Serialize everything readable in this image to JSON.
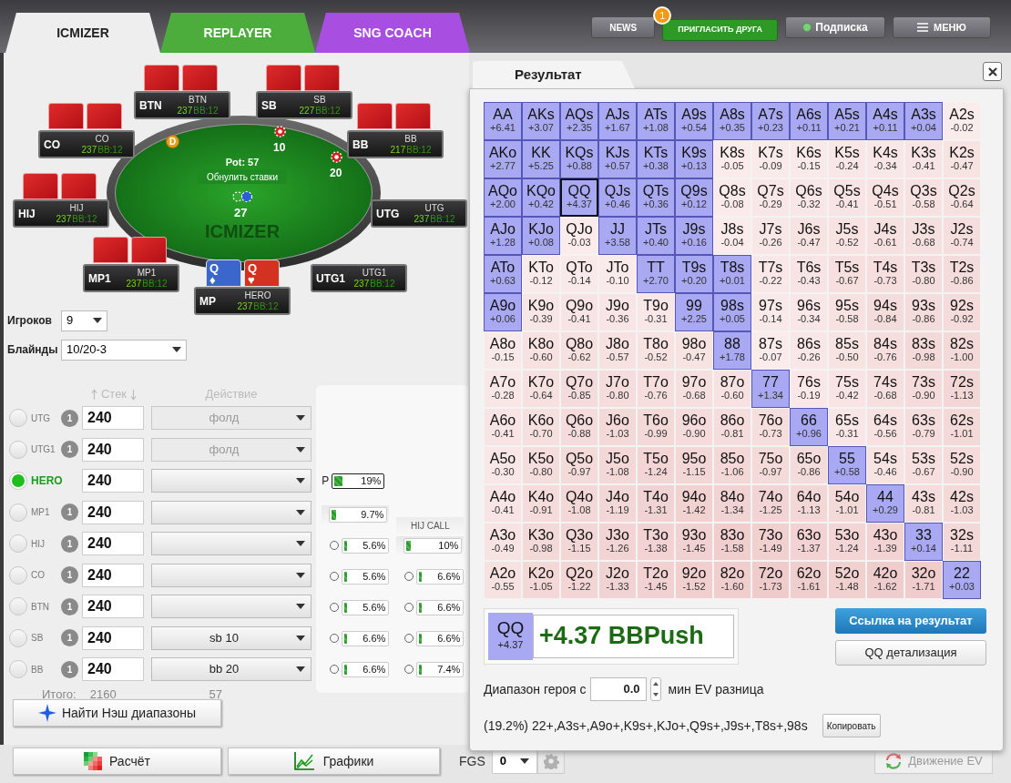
{
  "nav_tabs": [
    {
      "label": "ICMIZER",
      "selected": true,
      "color": "#eeeeee"
    },
    {
      "label": "REPLAYER",
      "selected": false,
      "color": "#4cad3c"
    },
    {
      "label": "SNG COACH",
      "selected": false,
      "color": "#a84ee0"
    }
  ],
  "top_buttons": [
    {
      "kind": "plain",
      "label": "NEWS"
    },
    {
      "kind": "invite",
      "label": "ПРИГЛАСИТЬ ДРУГА",
      "badge": "1"
    },
    {
      "kind": "status",
      "label": "Подписка"
    },
    {
      "kind": "menu",
      "label": "МЕНЮ"
    }
  ],
  "table": {
    "seats": [
      {
        "kind": "opponent",
        "position": "BTN",
        "name": "BTN",
        "stack": "237",
        "bb": "BB:12"
      },
      {
        "kind": "opponent",
        "position": "SB",
        "name": "SB",
        "stack": "227",
        "bb": "BB:12"
      },
      {
        "kind": "opponent",
        "position": "CO",
        "name": "CO",
        "stack": "237",
        "bb": "BB:12"
      },
      {
        "kind": "opponent",
        "position": "BB",
        "name": "BB",
        "stack": "217",
        "bb": "BB:12"
      },
      {
        "kind": "opponent",
        "position": "HIJ",
        "name": "HIJ",
        "stack": "237",
        "bb": "BB:12"
      },
      {
        "kind": "folded",
        "position": "UTG",
        "name": "UTG",
        "stack": "237",
        "bb": "BB:12"
      },
      {
        "kind": "opponent",
        "position": "MP1",
        "name": "MP1",
        "stack": "237",
        "bb": "BB:12"
      },
      {
        "kind": "folded",
        "position": "UTG1",
        "name": "UTG1",
        "stack": "237",
        "bb": "BB:12"
      },
      {
        "kind": "hero",
        "position": "MP",
        "name": "HERO",
        "stack": "237",
        "bb": "BB:12",
        "cards": [
          {
            "rank": "Q",
            "suit": "♦",
            "color": "#3b66cc"
          },
          {
            "rank": "Q",
            "suit": "♥",
            "color": "#d2321f"
          }
        ]
      }
    ],
    "dealer": "D",
    "bets": [
      {
        "amount": "10"
      },
      {
        "amount": "20"
      }
    ],
    "pot": "Pot: 57",
    "reset_button": "Обнулить ставки",
    "center_chips": "27",
    "felt_logo": "ICMIZER"
  },
  "settings": [
    {
      "label": "Игроков",
      "value": "9"
    },
    {
      "label": "Блайнды",
      "value": "10/20-3"
    }
  ],
  "players": {
    "stack_header": "Стек",
    "action_header": "Действие",
    "rows": [
      {
        "position": "UTG",
        "selected": false,
        "count": "1",
        "stack": "240",
        "action": "фолд",
        "disabled": true
      },
      {
        "position": "UTG1",
        "selected": false,
        "count": "1",
        "stack": "240",
        "action": "фолд",
        "disabled": true
      },
      {
        "position": "HERO",
        "selected": true,
        "stack": "240",
        "disabled": false
      },
      {
        "position": "MP1",
        "selected": false,
        "count": "1",
        "stack": "240",
        "disabled": false
      },
      {
        "position": "HIJ",
        "selected": false,
        "count": "1",
        "stack": "240",
        "disabled": false
      },
      {
        "position": "CO",
        "selected": false,
        "count": "1",
        "stack": "240",
        "disabled": false
      },
      {
        "position": "BTN",
        "selected": false,
        "count": "1",
        "stack": "240",
        "disabled": false
      },
      {
        "position": "SB",
        "selected": false,
        "count": "1",
        "stack": "240",
        "action": "sb 10",
        "disabled": false
      },
      {
        "position": "BB",
        "selected": false,
        "count": "1",
        "stack": "240",
        "action": "bb 20",
        "disabled": false
      }
    ],
    "total_label": "Итого:",
    "total_stack": "2160",
    "total_pot": "57"
  },
  "ranges": {
    "push": {
      "label": "P",
      "text": "19%",
      "level": 0.19
    },
    "columns": [
      {
        "items": [
          {
            "kind": "total",
            "text": "9.7%",
            "level": 0.097
          },
          {
            "kind": "option",
            "text": "5.6%",
            "level": 0.056,
            "selected": false
          },
          {
            "kind": "option",
            "text": "5.6%",
            "level": 0.056,
            "selected": false
          },
          {
            "kind": "option",
            "text": "5.6%",
            "level": 0.056,
            "selected": false
          },
          {
            "kind": "option",
            "text": "6.6%",
            "level": 0.066,
            "selected": false
          },
          {
            "kind": "option",
            "text": "6.6%",
            "level": 0.066,
            "selected": false
          }
        ]
      },
      {
        "title": "HIJ CALL",
        "items": [
          {
            "kind": "total",
            "text": "10%",
            "level": 0.1
          },
          {
            "kind": "option",
            "text": "6.6%",
            "level": 0.066,
            "selected": false
          },
          {
            "kind": "option",
            "text": "6.6%",
            "level": 0.066,
            "selected": false
          },
          {
            "kind": "option",
            "text": "6.6%",
            "level": 0.066,
            "selected": false
          },
          {
            "kind": "option",
            "text": "7.4%",
            "level": 0.074,
            "selected": false
          }
        ]
      }
    ]
  },
  "actions": {
    "nash_button": "Найти Нэш диапазоны",
    "calc_button": "Расчёт",
    "charts_button": "Графики",
    "fgs_label": "FGS",
    "fgs_value": "0",
    "ev_button": {
      "label": "Движение EV",
      "disabled": true
    }
  },
  "result": {
    "tab": "Результат",
    "grid": [
      [
        {
          "hand": "AA",
          "ev": "+6.41",
          "push": true,
          "selected": false
        },
        {
          "hand": "AKs",
          "ev": "+3.07",
          "push": true,
          "selected": false
        },
        {
          "hand": "AQs",
          "ev": "+2.35",
          "push": true,
          "selected": false
        },
        {
          "hand": "AJs",
          "ev": "+1.67",
          "push": true,
          "selected": false
        },
        {
          "hand": "ATs",
          "ev": "+1.08",
          "push": true,
          "selected": false
        },
        {
          "hand": "A9s",
          "ev": "+0.54",
          "push": true,
          "selected": false
        },
        {
          "hand": "A8s",
          "ev": "+0.35",
          "push": true,
          "selected": false
        },
        {
          "hand": "A7s",
          "ev": "+0.23",
          "push": true,
          "selected": false
        },
        {
          "hand": "A6s",
          "ev": "+0.11",
          "push": true,
          "selected": false
        },
        {
          "hand": "A5s",
          "ev": "+0.21",
          "push": true,
          "selected": false
        },
        {
          "hand": "A4s",
          "ev": "+0.11",
          "push": true,
          "selected": false
        },
        {
          "hand": "A3s",
          "ev": "+0.04",
          "push": true,
          "selected": false
        },
        {
          "hand": "A2s",
          "ev": "-0.02",
          "push": false,
          "selected": false
        }
      ],
      [
        {
          "hand": "AKo",
          "ev": "+2.77",
          "push": true,
          "selected": false
        },
        {
          "hand": "KK",
          "ev": "+5.25",
          "push": true,
          "selected": false
        },
        {
          "hand": "KQs",
          "ev": "+0.88",
          "push": true,
          "selected": false
        },
        {
          "hand": "KJs",
          "ev": "+0.57",
          "push": true,
          "selected": false
        },
        {
          "hand": "KTs",
          "ev": "+0.38",
          "push": true,
          "selected": false
        },
        {
          "hand": "K9s",
          "ev": "+0.13",
          "push": true,
          "selected": false
        },
        {
          "hand": "K8s",
          "ev": "-0.05",
          "push": false,
          "selected": false
        },
        {
          "hand": "K7s",
          "ev": "-0.09",
          "push": false,
          "selected": false
        },
        {
          "hand": "K6s",
          "ev": "-0.15",
          "push": false,
          "selected": false
        },
        {
          "hand": "K5s",
          "ev": "-0.24",
          "push": false,
          "selected": false
        },
        {
          "hand": "K4s",
          "ev": "-0.34",
          "push": false,
          "selected": false
        },
        {
          "hand": "K3s",
          "ev": "-0.41",
          "push": false,
          "selected": false
        },
        {
          "hand": "K2s",
          "ev": "-0.47",
          "push": false,
          "selected": false
        }
      ],
      [
        {
          "hand": "AQo",
          "ev": "+2.00",
          "push": true,
          "selected": false
        },
        {
          "hand": "KQo",
          "ev": "+0.42",
          "push": true,
          "selected": false
        },
        {
          "hand": "QQ",
          "ev": "+4.37",
          "push": true,
          "selected": true
        },
        {
          "hand": "QJs",
          "ev": "+0.46",
          "push": true,
          "selected": false
        },
        {
          "hand": "QTs",
          "ev": "+0.36",
          "push": true,
          "selected": false
        },
        {
          "hand": "Q9s",
          "ev": "+0.12",
          "push": true,
          "selected": false
        },
        {
          "hand": "Q8s",
          "ev": "-0.08",
          "push": false,
          "selected": false
        },
        {
          "hand": "Q7s",
          "ev": "-0.29",
          "push": false,
          "selected": false
        },
        {
          "hand": "Q6s",
          "ev": "-0.32",
          "push": false,
          "selected": false
        },
        {
          "hand": "Q5s",
          "ev": "-0.41",
          "push": false,
          "selected": false
        },
        {
          "hand": "Q4s",
          "ev": "-0.51",
          "push": false,
          "selected": false
        },
        {
          "hand": "Q3s",
          "ev": "-0.58",
          "push": false,
          "selected": false
        },
        {
          "hand": "Q2s",
          "ev": "-0.64",
          "push": false,
          "selected": false
        }
      ],
      [
        {
          "hand": "AJo",
          "ev": "+1.28",
          "push": true,
          "selected": false
        },
        {
          "hand": "KJo",
          "ev": "+0.08",
          "push": true,
          "selected": false
        },
        {
          "hand": "QJo",
          "ev": "-0.03",
          "push": false,
          "selected": false
        },
        {
          "hand": "JJ",
          "ev": "+3.58",
          "push": true,
          "selected": false
        },
        {
          "hand": "JTs",
          "ev": "+0.40",
          "push": true,
          "selected": false
        },
        {
          "hand": "J9s",
          "ev": "+0.16",
          "push": true,
          "selected": false
        },
        {
          "hand": "J8s",
          "ev": "-0.04",
          "push": false,
          "selected": false
        },
        {
          "hand": "J7s",
          "ev": "-0.26",
          "push": false,
          "selected": false
        },
        {
          "hand": "J6s",
          "ev": "-0.47",
          "push": false,
          "selected": false
        },
        {
          "hand": "J5s",
          "ev": "-0.52",
          "push": false,
          "selected": false
        },
        {
          "hand": "J4s",
          "ev": "-0.61",
          "push": false,
          "selected": false
        },
        {
          "hand": "J3s",
          "ev": "-0.68",
          "push": false,
          "selected": false
        },
        {
          "hand": "J2s",
          "ev": "-0.74",
          "push": false,
          "selected": false
        }
      ],
      [
        {
          "hand": "ATo",
          "ev": "+0.63",
          "push": true,
          "selected": false
        },
        {
          "hand": "KTo",
          "ev": "-0.12",
          "push": false,
          "selected": false
        },
        {
          "hand": "QTo",
          "ev": "-0.14",
          "push": false,
          "selected": false
        },
        {
          "hand": "JTo",
          "ev": "-0.10",
          "push": false,
          "selected": false
        },
        {
          "hand": "TT",
          "ev": "+2.70",
          "push": true,
          "selected": false
        },
        {
          "hand": "T9s",
          "ev": "+0.20",
          "push": true,
          "selected": false
        },
        {
          "hand": "T8s",
          "ev": "+0.01",
          "push": true,
          "selected": false
        },
        {
          "hand": "T7s",
          "ev": "-0.22",
          "push": false,
          "selected": false
        },
        {
          "hand": "T6s",
          "ev": "-0.43",
          "push": false,
          "selected": false
        },
        {
          "hand": "T5s",
          "ev": "-0.67",
          "push": false,
          "selected": false
        },
        {
          "hand": "T4s",
          "ev": "-0.73",
          "push": false,
          "selected": false
        },
        {
          "hand": "T3s",
          "ev": "-0.80",
          "push": false,
          "selected": false
        },
        {
          "hand": "T2s",
          "ev": "-0.86",
          "push": false,
          "selected": false
        }
      ],
      [
        {
          "hand": "A9o",
          "ev": "+0.06",
          "push": true,
          "selected": false
        },
        {
          "hand": "K9o",
          "ev": "-0.39",
          "push": false,
          "selected": false
        },
        {
          "hand": "Q9o",
          "ev": "-0.41",
          "push": false,
          "selected": false
        },
        {
          "hand": "J9o",
          "ev": "-0.36",
          "push": false,
          "selected": false
        },
        {
          "hand": "T9o",
          "ev": "-0.31",
          "push": false,
          "selected": false
        },
        {
          "hand": "99",
          "ev": "+2.25",
          "push": true,
          "selected": false
        },
        {
          "hand": "98s",
          "ev": "+0.05",
          "push": true,
          "selected": false
        },
        {
          "hand": "97s",
          "ev": "-0.14",
          "push": false,
          "selected": false
        },
        {
          "hand": "96s",
          "ev": "-0.34",
          "push": false,
          "selected": false
        },
        {
          "hand": "95s",
          "ev": "-0.58",
          "push": false,
          "selected": false
        },
        {
          "hand": "94s",
          "ev": "-0.84",
          "push": false,
          "selected": false
        },
        {
          "hand": "93s",
          "ev": "-0.86",
          "push": false,
          "selected": false
        },
        {
          "hand": "92s",
          "ev": "-0.92",
          "push": false,
          "selected": false
        }
      ],
      [
        {
          "hand": "A8o",
          "ev": "-0.15",
          "push": false,
          "selected": false
        },
        {
          "hand": "K8o",
          "ev": "-0.60",
          "push": false,
          "selected": false
        },
        {
          "hand": "Q8o",
          "ev": "-0.62",
          "push": false,
          "selected": false
        },
        {
          "hand": "J8o",
          "ev": "-0.57",
          "push": false,
          "selected": false
        },
        {
          "hand": "T8o",
          "ev": "-0.52",
          "push": false,
          "selected": false
        },
        {
          "hand": "98o",
          "ev": "-0.47",
          "push": false,
          "selected": false
        },
        {
          "hand": "88",
          "ev": "+1.78",
          "push": true,
          "selected": false
        },
        {
          "hand": "87s",
          "ev": "-0.07",
          "push": false,
          "selected": false
        },
        {
          "hand": "86s",
          "ev": "-0.26",
          "push": false,
          "selected": false
        },
        {
          "hand": "85s",
          "ev": "-0.50",
          "push": false,
          "selected": false
        },
        {
          "hand": "84s",
          "ev": "-0.76",
          "push": false,
          "selected": false
        },
        {
          "hand": "83s",
          "ev": "-0.98",
          "push": false,
          "selected": false
        },
        {
          "hand": "82s",
          "ev": "-1.00",
          "push": false,
          "selected": false
        }
      ],
      [
        {
          "hand": "A7o",
          "ev": "-0.28",
          "push": false,
          "selected": false
        },
        {
          "hand": "K7o",
          "ev": "-0.64",
          "push": false,
          "selected": false
        },
        {
          "hand": "Q7o",
          "ev": "-0.85",
          "push": false,
          "selected": false
        },
        {
          "hand": "J7o",
          "ev": "-0.80",
          "push": false,
          "selected": false
        },
        {
          "hand": "T7o",
          "ev": "-0.76",
          "push": false,
          "selected": false
        },
        {
          "hand": "97o",
          "ev": "-0.68",
          "push": false,
          "selected": false
        },
        {
          "hand": "87o",
          "ev": "-0.60",
          "push": false,
          "selected": false
        },
        {
          "hand": "77",
          "ev": "+1.34",
          "push": true,
          "selected": false
        },
        {
          "hand": "76s",
          "ev": "-0.19",
          "push": false,
          "selected": false
        },
        {
          "hand": "75s",
          "ev": "-0.42",
          "push": false,
          "selected": false
        },
        {
          "hand": "74s",
          "ev": "-0.68",
          "push": false,
          "selected": false
        },
        {
          "hand": "73s",
          "ev": "-0.90",
          "push": false,
          "selected": false
        },
        {
          "hand": "72s",
          "ev": "-1.13",
          "push": false,
          "selected": false
        }
      ],
      [
        {
          "hand": "A6o",
          "ev": "-0.41",
          "push": false,
          "selected": false
        },
        {
          "hand": "K6o",
          "ev": "-0.70",
          "push": false,
          "selected": false
        },
        {
          "hand": "Q6o",
          "ev": "-0.88",
          "push": false,
          "selected": false
        },
        {
          "hand": "J6o",
          "ev": "-1.03",
          "push": false,
          "selected": false
        },
        {
          "hand": "T6o",
          "ev": "-0.99",
          "push": false,
          "selected": false
        },
        {
          "hand": "96o",
          "ev": "-0.90",
          "push": false,
          "selected": false
        },
        {
          "hand": "86o",
          "ev": "-0.81",
          "push": false,
          "selected": false
        },
        {
          "hand": "76o",
          "ev": "-0.73",
          "push": false,
          "selected": false
        },
        {
          "hand": "66",
          "ev": "+0.96",
          "push": true,
          "selected": false
        },
        {
          "hand": "65s",
          "ev": "-0.31",
          "push": false,
          "selected": false
        },
        {
          "hand": "64s",
          "ev": "-0.56",
          "push": false,
          "selected": false
        },
        {
          "hand": "63s",
          "ev": "-0.79",
          "push": false,
          "selected": false
        },
        {
          "hand": "62s",
          "ev": "-1.01",
          "push": false,
          "selected": false
        }
      ],
      [
        {
          "hand": "A5o",
          "ev": "-0.30",
          "push": false,
          "selected": false
        },
        {
          "hand": "K5o",
          "ev": "-0.80",
          "push": false,
          "selected": false
        },
        {
          "hand": "Q5o",
          "ev": "-0.97",
          "push": false,
          "selected": false
        },
        {
          "hand": "J5o",
          "ev": "-1.08",
          "push": false,
          "selected": false
        },
        {
          "hand": "T5o",
          "ev": "-1.24",
          "push": false,
          "selected": false
        },
        {
          "hand": "95o",
          "ev": "-1.15",
          "push": false,
          "selected": false
        },
        {
          "hand": "85o",
          "ev": "-1.06",
          "push": false,
          "selected": false
        },
        {
          "hand": "75o",
          "ev": "-0.97",
          "push": false,
          "selected": false
        },
        {
          "hand": "65o",
          "ev": "-0.86",
          "push": false,
          "selected": false
        },
        {
          "hand": "55",
          "ev": "+0.58",
          "push": true,
          "selected": false
        },
        {
          "hand": "54s",
          "ev": "-0.46",
          "push": false,
          "selected": false
        },
        {
          "hand": "53s",
          "ev": "-0.67",
          "push": false,
          "selected": false
        },
        {
          "hand": "52s",
          "ev": "-0.90",
          "push": false,
          "selected": false
        }
      ],
      [
        {
          "hand": "A4o",
          "ev": "-0.41",
          "push": false,
          "selected": false
        },
        {
          "hand": "K4o",
          "ev": "-0.91",
          "push": false,
          "selected": false
        },
        {
          "hand": "Q4o",
          "ev": "-1.08",
          "push": false,
          "selected": false
        },
        {
          "hand": "J4o",
          "ev": "-1.19",
          "push": false,
          "selected": false
        },
        {
          "hand": "T4o",
          "ev": "-1.31",
          "push": false,
          "selected": false
        },
        {
          "hand": "94o",
          "ev": "-1.42",
          "push": false,
          "selected": false
        },
        {
          "hand": "84o",
          "ev": "-1.34",
          "push": false,
          "selected": false
        },
        {
          "hand": "74o",
          "ev": "-1.25",
          "push": false,
          "selected": false
        },
        {
          "hand": "64o",
          "ev": "-1.13",
          "push": false,
          "selected": false
        },
        {
          "hand": "54o",
          "ev": "-1.01",
          "push": false,
          "selected": false
        },
        {
          "hand": "44",
          "ev": "+0.29",
          "push": true,
          "selected": false
        },
        {
          "hand": "43s",
          "ev": "-0.81",
          "push": false,
          "selected": false
        },
        {
          "hand": "42s",
          "ev": "-1.03",
          "push": false,
          "selected": false
        }
      ],
      [
        {
          "hand": "A3o",
          "ev": "-0.49",
          "push": false,
          "selected": false
        },
        {
          "hand": "K3o",
          "ev": "-0.98",
          "push": false,
          "selected": false
        },
        {
          "hand": "Q3o",
          "ev": "-1.15",
          "push": false,
          "selected": false
        },
        {
          "hand": "J3o",
          "ev": "-1.26",
          "push": false,
          "selected": false
        },
        {
          "hand": "T3o",
          "ev": "-1.38",
          "push": false,
          "selected": false
        },
        {
          "hand": "93o",
          "ev": "-1.45",
          "push": false,
          "selected": false
        },
        {
          "hand": "83o",
          "ev": "-1.58",
          "push": false,
          "selected": false
        },
        {
          "hand": "73o",
          "ev": "-1.49",
          "push": false,
          "selected": false
        },
        {
          "hand": "63o",
          "ev": "-1.37",
          "push": false,
          "selected": false
        },
        {
          "hand": "53o",
          "ev": "-1.24",
          "push": false,
          "selected": false
        },
        {
          "hand": "43o",
          "ev": "-1.39",
          "push": false,
          "selected": false
        },
        {
          "hand": "33",
          "ev": "+0.14",
          "push": true,
          "selected": false
        },
        {
          "hand": "32s",
          "ev": "-1.11",
          "push": false,
          "selected": false
        }
      ],
      [
        {
          "hand": "A2o",
          "ev": "-0.55",
          "push": false,
          "selected": false
        },
        {
          "hand": "K2o",
          "ev": "-1.05",
          "push": false,
          "selected": false
        },
        {
          "hand": "Q2o",
          "ev": "-1.22",
          "push": false,
          "selected": false
        },
        {
          "hand": "J2o",
          "ev": "-1.33",
          "push": false,
          "selected": false
        },
        {
          "hand": "T2o",
          "ev": "-1.45",
          "push": false,
          "selected": false
        },
        {
          "hand": "92o",
          "ev": "-1.52",
          "push": false,
          "selected": false
        },
        {
          "hand": "82o",
          "ev": "-1.60",
          "push": false,
          "selected": false
        },
        {
          "hand": "72o",
          "ev": "-1.73",
          "push": false,
          "selected": false
        },
        {
          "hand": "62o",
          "ev": "-1.61",
          "push": false,
          "selected": false
        },
        {
          "hand": "52o",
          "ev": "-1.48",
          "push": false,
          "selected": false
        },
        {
          "hand": "42o",
          "ev": "-1.62",
          "push": false,
          "selected": false
        },
        {
          "hand": "32o",
          "ev": "-1.71",
          "push": false,
          "selected": false
        },
        {
          "hand": "22",
          "ev": "+0.03",
          "push": true,
          "selected": false
        }
      ]
    ],
    "summary": {
      "hand": "QQ",
      "ev": "+4.37",
      "verdict": "+4.37 BBPush"
    },
    "link_button": "Ссылка на результат",
    "detail_button": "QQ детализация",
    "filter": {
      "label": "Диапазон героя с",
      "value": "0.0",
      "suffix": "мин EV разница"
    },
    "range_text": "(19.2%) 22+,A3s+,A9o+,K9s+,KJo+,Q9s+,J9s+,T8s+,98s",
    "copy_button": "Копировать"
  }
}
